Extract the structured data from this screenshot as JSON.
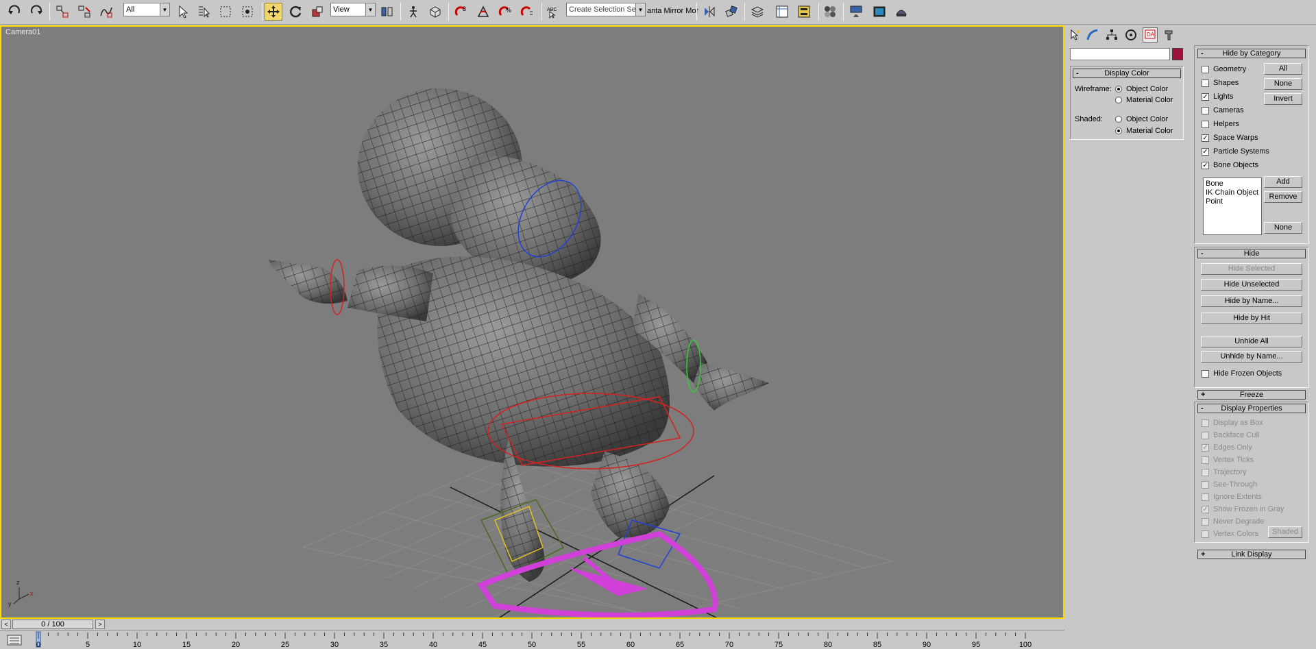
{
  "toolbar": {
    "selection_filter": "All",
    "ref_coord": "View",
    "selection_set_placeholder": "Create Selection Set",
    "mirror_text": "anta Mirror Mor",
    "icons": [
      "undo-icon",
      "redo-icon",
      "select-link-icon",
      "unlink-icon",
      "bind-spacewarp-icon",
      "select-object-icon",
      "select-by-name-icon",
      "rect-region-icon",
      "window-crossing-icon",
      "move-icon",
      "rotate-icon",
      "scale-icon",
      "pivot-icon",
      "manipulate-icon",
      "keyboard-shortcut-icon",
      "snap-3d-icon",
      "angle-snap-icon",
      "percent-snap-icon",
      "spinner-snap-icon",
      "named-selection-icon",
      "mirror-icon",
      "align-icon",
      "layer-manager-icon",
      "curve-editor-icon",
      "schematic-view-icon",
      "material-editor-icon",
      "render-setup-icon",
      "rendered-frame-icon",
      "quick-render-icon"
    ]
  },
  "viewport": {
    "label": "Camera01",
    "border_color": "#ffd800",
    "background": "#7d7d7d"
  },
  "timeslider": {
    "value": "0 / 100",
    "prev": "<",
    "next": ">"
  },
  "trackbar": {
    "ticks": [
      "0",
      "5",
      "10",
      "15",
      "20",
      "25",
      "30",
      "35",
      "40",
      "45",
      "50",
      "55",
      "60",
      "65",
      "70",
      "75",
      "80",
      "85",
      "90",
      "95",
      "100"
    ]
  },
  "command_panel": {
    "tabs": [
      "create-tab-icon",
      "modify-tab-icon",
      "hierarchy-tab-icon",
      "motion-tab-icon",
      "display-tab-icon",
      "utilities-tab-icon"
    ],
    "object_color": "#a0103c",
    "display_color": {
      "title": "Display Color",
      "wireframe_label": "Wireframe:",
      "shaded_label": "Shaded:",
      "object_color": "Object Color",
      "material_color": "Material Color",
      "wireframe_selected": "Object Color",
      "shaded_selected": "Material Color"
    },
    "hide_by_category": {
      "title": "Hide by Category",
      "items": [
        {
          "label": "Geometry",
          "checked": false
        },
        {
          "label": "Shapes",
          "checked": false
        },
        {
          "label": "Lights",
          "checked": true
        },
        {
          "label": "Cameras",
          "checked": false
        },
        {
          "label": "Helpers",
          "checked": false
        },
        {
          "label": "Space Warps",
          "checked": true
        },
        {
          "label": "Particle Systems",
          "checked": true
        },
        {
          "label": "Bone Objects",
          "checked": true
        }
      ],
      "all_button": "All",
      "none_button": "None",
      "invert_button": "Invert",
      "list": [
        "Bone",
        "IK Chain Object",
        "Point"
      ],
      "add_button": "Add",
      "remove_button": "Remove",
      "list_none_button": "None"
    },
    "hide": {
      "title": "Hide",
      "hide_selected": "Hide Selected",
      "hide_unselected": "Hide Unselected",
      "hide_by_name": "Hide by Name...",
      "hide_by_hit": "Hide by Hit",
      "unhide_all": "Unhide All",
      "unhide_by_name": "Unhide by Name...",
      "hide_frozen": "Hide Frozen Objects"
    },
    "freeze": {
      "title": "Freeze"
    },
    "display_properties": {
      "title": "Display Properties",
      "items": [
        {
          "label": "Display as Box",
          "checked": false
        },
        {
          "label": "Backface Cull",
          "checked": false
        },
        {
          "label": "Edges Only",
          "checked": true
        },
        {
          "label": "Vertex Ticks",
          "checked": false
        },
        {
          "label": "Trajectory",
          "checked": false
        },
        {
          "label": "See-Through",
          "checked": false
        },
        {
          "label": "Ignore Extents",
          "checked": false
        },
        {
          "label": "Show Frozen in Gray",
          "checked": true
        },
        {
          "label": "Never Degrade",
          "checked": false
        },
        {
          "label": "Vertex Colors",
          "checked": false
        }
      ],
      "shaded_button": "Shaded"
    },
    "link_display": {
      "title": "Link Display"
    }
  }
}
